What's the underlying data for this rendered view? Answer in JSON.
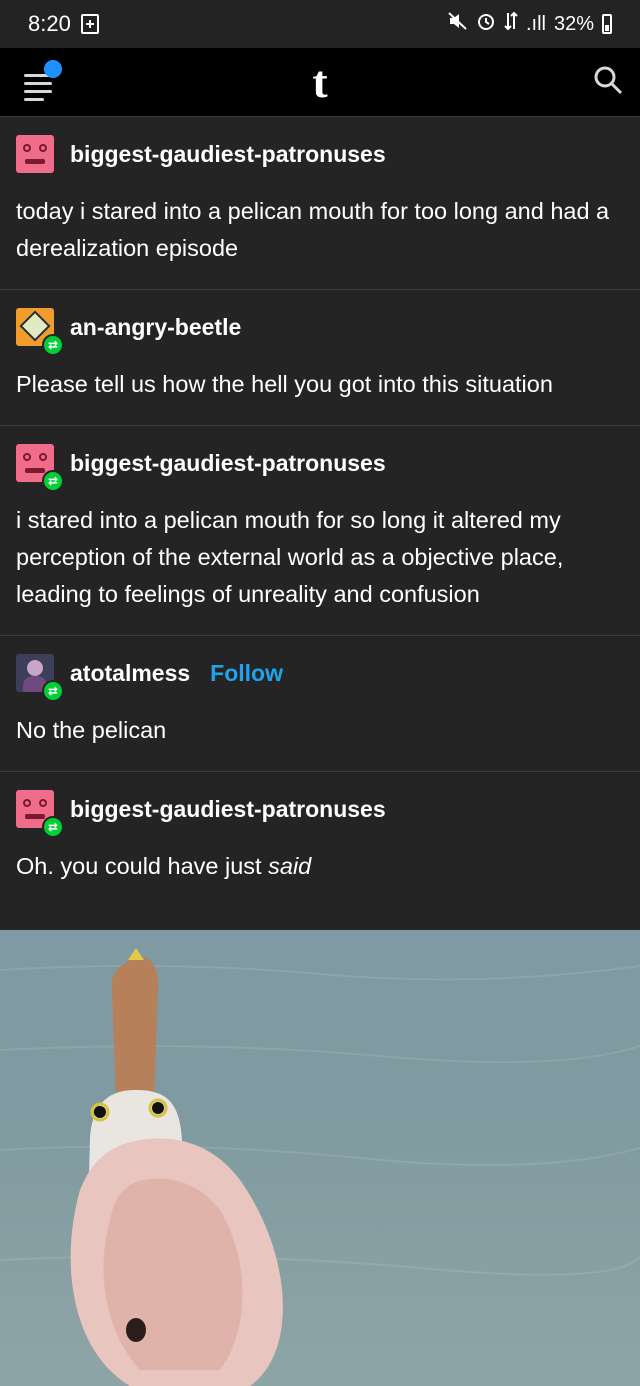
{
  "status_bar": {
    "time": "8:20",
    "signal_text": ".ıll",
    "battery": "32%",
    "icons": [
      "plus-box-icon",
      "mute-icon",
      "alarm-icon",
      "data-icon",
      "signal-icon",
      "battery-icon"
    ]
  },
  "app_bar": {
    "logo": "t",
    "icons": [
      "menu-icon",
      "search-icon"
    ],
    "accent": "#1e90ff"
  },
  "posts": [
    {
      "username": "biggest-gaudiest-patronuses",
      "avatar": "pink-face",
      "reblog": false,
      "follow": "",
      "body": "today i stared into a pelican mouth for too long and had a derealization episode"
    },
    {
      "username": "an-angry-beetle",
      "avatar": "orange-diamond",
      "reblog": true,
      "follow": "",
      "body": "Please tell us how the hell you got into this situation"
    },
    {
      "username": "biggest-gaudiest-patronuses",
      "avatar": "pink-face",
      "reblog": true,
      "follow": "",
      "body": "i stared into a pelican mouth for so long it altered my perception of the external world as a objective place, leading to feelings of unreality and confusion"
    },
    {
      "username": "atotalmess",
      "avatar": "anime-portrait",
      "reblog": true,
      "follow": "Follow",
      "body": "No the pelican"
    },
    {
      "username": "biggest-gaudiest-patronuses",
      "avatar": "pink-face",
      "reblog": true,
      "follow": "",
      "body_prefix": "Oh. you could have just ",
      "body_emphasis": "said"
    }
  ],
  "colors": {
    "background": "#242424",
    "follow": "#1fa3ec",
    "reblog_badge": "#00cf35"
  }
}
